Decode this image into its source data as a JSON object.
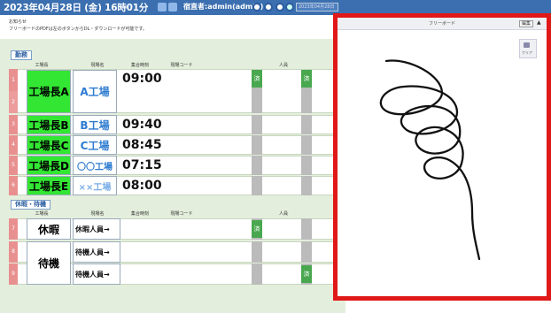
{
  "topbar": {
    "datetime": "2023年04月28日 (金) 16時01分",
    "login_user": "宿直者:admin(admin)",
    "date_field": "2023年04月28日"
  },
  "note": {
    "title": "お知らせ",
    "text": "フリーボードのPDFは左のボタンからDL・ダウンロードが可能です。"
  },
  "duty": {
    "section_label": "勤務",
    "headers": [
      "工場長",
      "現場名",
      "集合時刻",
      "現場コード",
      "人員"
    ],
    "rows": [
      {
        "num_a": "1",
        "num_b": "2",
        "name": "工場長A",
        "place": "A工場",
        "time": "09:00"
      },
      {
        "num": "3",
        "name": "工場長B",
        "place": "B工場",
        "time": "09:40"
      },
      {
        "num": "4",
        "name": "工場長C",
        "place": "C工場",
        "time": "08:45"
      },
      {
        "num": "5",
        "name": "工場長D",
        "place": "〇〇工場",
        "time": "07:15"
      },
      {
        "num": "6",
        "name": "工場長E",
        "place": "××工場",
        "time": "08:00"
      }
    ],
    "done_label": "済"
  },
  "rest": {
    "section_label": "休暇・待機",
    "headers": [
      "工場長",
      "現場名",
      "集合時刻",
      "現場コード",
      "人員"
    ],
    "rows": [
      {
        "num": "7",
        "name": "休暇",
        "member": "休暇人員→"
      },
      {
        "num": "8",
        "member": "待機人員→"
      },
      {
        "num": "9",
        "member": "待機人員→"
      }
    ],
    "standby_name": "待機"
  },
  "freeboard": {
    "title": "フリーボード",
    "button_label": "編集",
    "clear_label": "クリア",
    "toggle": "▲"
  },
  "colors": {
    "header_blue": "#3b6fb0",
    "highlight_red": "#e01818",
    "done_green": "#49a84f",
    "name_green": "#33e633",
    "place_blue": "#2d7bd0"
  }
}
